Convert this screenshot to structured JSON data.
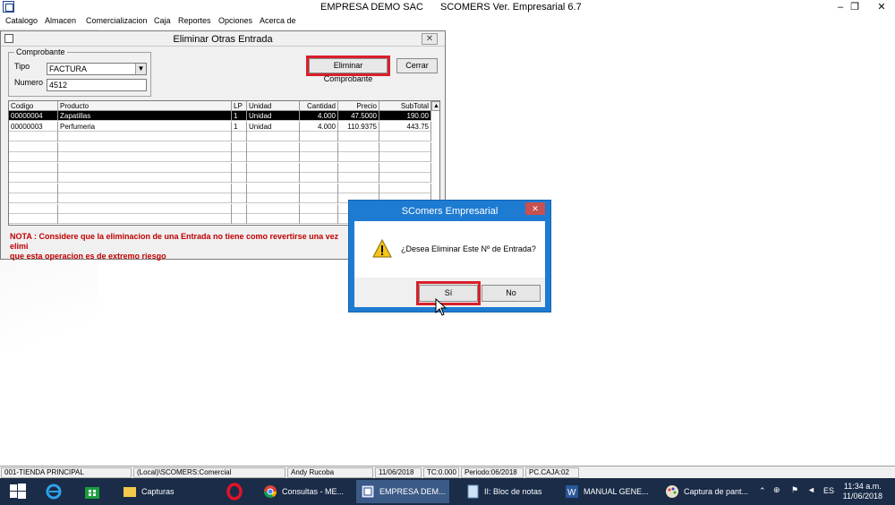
{
  "app": {
    "company": "EMPRESA DEMO SAC",
    "product": "SCOMERS Ver. Empresarial  6.7",
    "minimize": "–",
    "restore": "❐",
    "close": "✕"
  },
  "menu": [
    "Catalogo",
    "Almacen",
    "Comercializacion",
    "Caja",
    "Reportes",
    "Opciones",
    "Acerca de"
  ],
  "form": {
    "title": "Eliminar Otras Entrada",
    "close": "✕",
    "group_label": "Comprobante",
    "tipo_label": "Tipo",
    "tipo_value": "FACTURA",
    "numero_label": "Numero",
    "numero_value": "4512",
    "delete_button": "Eliminar Comprobante",
    "close_button": "Cerrar",
    "grid": {
      "columns": [
        "Codigo",
        "Producto",
        "LP",
        "Unidad",
        "Cantidad",
        "Precio",
        "SubTotal"
      ],
      "rows": [
        [
          "00000004",
          "Zapatillas",
          "1",
          "Unidad",
          "4.000",
          "47.5000",
          "190.00"
        ],
        [
          "00000003",
          "Perfumeria",
          "1",
          "Unidad",
          "4.000",
          "110.9375",
          "443.75"
        ]
      ],
      "selected_row": 0
    },
    "note_line1": "NOTA : Considere que la eliminacion de una Entrada no tiene como revertirse una vez elimi",
    "note_line2": "que esta operacion es de extremo riesgo"
  },
  "dialog": {
    "title": "SComers Empresarial",
    "message": "¿Desea Eliminar Este Nº de Entrada?",
    "yes": "Sí",
    "no": "No",
    "close": "✕"
  },
  "statusbar": [
    "001-TIENDA PRINCIPAL",
    "(Local)\\SCOMERS:Comercial",
    "Andy Rucoba",
    "11/06/2018",
    "TC:0.000",
    "Periodo:06/2018",
    "PC.CAJA:02"
  ],
  "taskbar": {
    "tasks": [
      "Capturas",
      "Consultas - ME...",
      "EMPRESA DEM...",
      "II: Bloc de notas",
      "MANUAL GENE...",
      "Captura de pant..."
    ],
    "clock_time": "11:34 a.m.",
    "clock_date": "11/06/2018",
    "tray_lang": "ES"
  },
  "colors": {
    "highlight": "#d8202a",
    "dialog_frame": "#1e7bd2",
    "note": "#c00000",
    "taskbar": "#1a2c48"
  }
}
